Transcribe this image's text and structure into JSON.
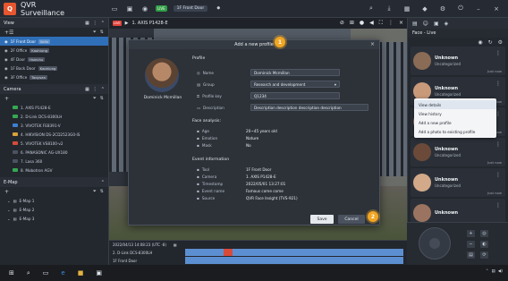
{
  "app": {
    "title": "QVR Surveillance",
    "logo": "Q"
  },
  "topbar": {
    "icons": [
      "monitor-icon",
      "display-icon",
      "camera-icon",
      "record-icon"
    ],
    "badge_text": "LIVE",
    "front_door_label": "1F Front Door",
    "right_icons": [
      "search-icon",
      "download-icon",
      "layout-icon",
      "alert-icon",
      "gear-icon",
      "power-icon"
    ]
  },
  "left": {
    "view_header": "View",
    "views": [
      {
        "label": "1F Front Door",
        "tag": "Kelin",
        "selected": true
      },
      {
        "label": "2F Office",
        "tag": "Kaohiung",
        "selected": false
      },
      {
        "label": "4F Door",
        "tag": "Hsinchu",
        "selected": false
      },
      {
        "label": "1F Back Door",
        "tag": "Kaohiung",
        "selected": false
      },
      {
        "label": "3F Office",
        "tag": "Taoyuan",
        "selected": false
      }
    ],
    "camera_header": "Camera",
    "cameras": [
      {
        "label": "1. AXIS P1428-E",
        "color": "g"
      },
      {
        "label": "2. D-Link DCS-8300LH",
        "color": "g"
      },
      {
        "label": "3. VIVOTEK FE8391-V",
        "color": "b"
      },
      {
        "label": "4. HIKVISION DS-2CD2523G0-IS",
        "color": "y"
      },
      {
        "label": "5. VIVOTEK VS8100-v2",
        "color": "r"
      },
      {
        "label": "6. PANASONIC AG-UX180",
        "color": "n"
      },
      {
        "label": "7. Lasa 360",
        "color": "n"
      },
      {
        "label": "8. Mobotron AGV",
        "color": "g"
      }
    ],
    "emap_header": "E-Map",
    "emaps": [
      "E-Map 1",
      "E-Map 2",
      "E-Map 3"
    ]
  },
  "center": {
    "camera_title": "1. AXIS P1428-E",
    "timeline": {
      "date": "2022/04/13 14:08:23 (UTC -8)",
      "tracks": [
        "2. D-Link DCS-8300LH",
        "1F Front Door"
      ]
    }
  },
  "dialog": {
    "title": "Add a new profile",
    "photo_name": "Dominick Mcmillan",
    "profile_section": "Profile",
    "fields": [
      {
        "label": "Name",
        "value": "Dominick Mcmillan"
      },
      {
        "label": "Group",
        "value": "Research and development"
      },
      {
        "label": "Profile key",
        "value": "Q1234"
      },
      {
        "label": "Description",
        "value": "Description description description description"
      }
    ],
    "face_section": "Face analysis:",
    "face_rows": [
      {
        "label": "Age",
        "value": "20~45 years old"
      },
      {
        "label": "Emotion",
        "value": "Nature"
      },
      {
        "label": "Mask",
        "value": "No"
      }
    ],
    "event_section": "Event information",
    "event_rows": [
      {
        "label": "Tool",
        "value": "1F Front Door"
      },
      {
        "label": "Camera",
        "value": "1. AXIS P1428-E"
      },
      {
        "label": "Timestamp",
        "value": "2022/05/01 13:27:01"
      },
      {
        "label": "Event name",
        "value": "Famous come come"
      },
      {
        "label": "Source",
        "value": "QVR Face Insight (TVS-921)"
      }
    ],
    "save_label": "Save",
    "cancel_label": "Cancel",
    "step1": "1",
    "step2": "2"
  },
  "right": {
    "title": "Face - Live",
    "cards": [
      {
        "name": "Unknown",
        "group": "Uncategorized",
        "time": "Just now"
      },
      {
        "name": "Unknown",
        "group": "Uncategorized",
        "time": "Just now"
      },
      {
        "name": "Unknown",
        "group": "Uncategorized",
        "time": "Just now"
      },
      {
        "name": "Unknown",
        "group": "Uncategorized",
        "time": "Just now"
      },
      {
        "name": "Unknown",
        "group": "Uncategorized",
        "time": "Just now"
      },
      {
        "name": "Unknown",
        "group": "",
        "time": ""
      }
    ],
    "context_menu": [
      "View details",
      "View history",
      "Add a new profile",
      "Add a photo to existing profile"
    ]
  },
  "colors": {
    "accent": "#2f6fb8",
    "step": "#f2a623",
    "live": "#e0413a"
  }
}
